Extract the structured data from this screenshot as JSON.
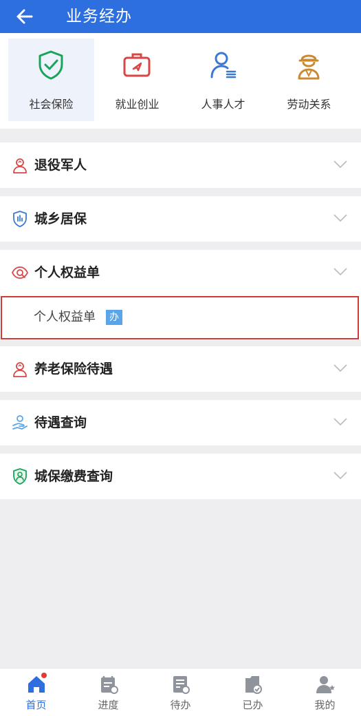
{
  "header": {
    "title": "业务经办",
    "back_icon": "arrow-left-icon"
  },
  "categories": [
    {
      "label": "社会保险",
      "icon": "shield-check-icon",
      "color": "#1aa35a"
    },
    {
      "label": "就业创业",
      "icon": "briefcase-icon",
      "color": "#d84646"
    },
    {
      "label": "人事人才",
      "icon": "person-list-icon",
      "color": "#3a78d8"
    },
    {
      "label": "劳动关系",
      "icon": "worker-icon",
      "color": "#c88a32"
    }
  ],
  "sections": [
    {
      "title": "退役军人",
      "icon": "veteran-icon"
    },
    {
      "title": "城乡居保",
      "icon": "shield-chart-icon"
    },
    {
      "title": "个人权益单",
      "icon": "eye-icon"
    },
    {
      "title": "养老保险待遇",
      "icon": "pension-icon"
    },
    {
      "title": "待遇查询",
      "icon": "hand-query-icon"
    },
    {
      "title": "城保缴费查询",
      "icon": "shield-person-icon"
    }
  ],
  "sub_item": {
    "label": "个人权益单",
    "badge": "办"
  },
  "tabbar": [
    {
      "label": "首页",
      "icon": "home-icon",
      "active": true
    },
    {
      "label": "进度",
      "icon": "progress-icon",
      "active": false
    },
    {
      "label": "待办",
      "icon": "todo-icon",
      "active": false
    },
    {
      "label": "已办",
      "icon": "done-icon",
      "active": false
    },
    {
      "label": "我的",
      "icon": "profile-icon",
      "active": false
    }
  ],
  "colors": {
    "brand": "#2e6fe0",
    "highlight_border": "#d23a3a",
    "badge": "#5aa4ea"
  }
}
